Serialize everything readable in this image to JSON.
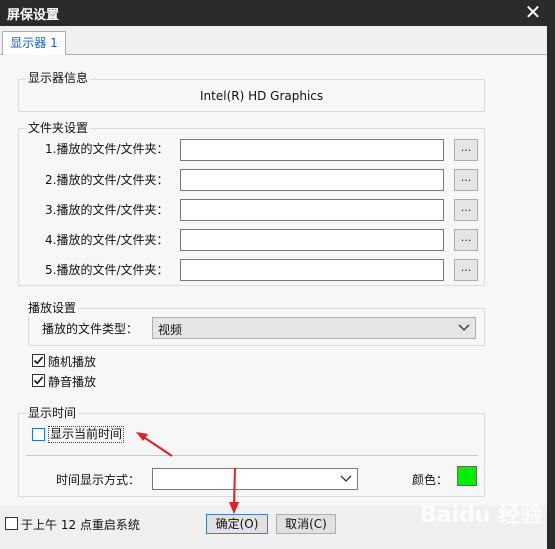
{
  "window": {
    "title": "屏保设置",
    "close_glyph": "✕"
  },
  "tabs": [
    {
      "label": "显示器 1"
    }
  ],
  "monitor_info": {
    "legend": "显示器信息",
    "adapter": "Intel(R) HD Graphics"
  },
  "folders": {
    "legend": "文件夹设置",
    "browse_label": "...",
    "items": [
      {
        "label": "1.播放的文件/文件夹：",
        "value": ""
      },
      {
        "label": "2.播放的文件/文件夹：",
        "value": ""
      },
      {
        "label": "3.播放的文件/文件夹：",
        "value": ""
      },
      {
        "label": "4.播放的文件/文件夹：",
        "value": ""
      },
      {
        "label": "5.播放的文件/文件夹：",
        "value": ""
      }
    ]
  },
  "playback": {
    "legend": "播放设置",
    "type_label": "播放的文件类型：",
    "type_value": "视频",
    "shuffle_label": "随机播放",
    "shuffle_checked": true,
    "mute_label": "静音播放",
    "mute_checked": true
  },
  "display_time": {
    "legend": "显示时间",
    "show_label": "显示当前时间",
    "show_checked": false,
    "format_label": "时间显示方式：",
    "format_value": "",
    "color_label": "颜色：",
    "color_value": "#00ee00"
  },
  "footer": {
    "restart_label": "于上午 12 点重启系统",
    "restart_checked": false,
    "ok_label": "确定(O)",
    "cancel_label": "取消(C)"
  },
  "annotations": {
    "arrow_color": "#e32020"
  },
  "watermark": {
    "text": "Baidu 经验"
  }
}
